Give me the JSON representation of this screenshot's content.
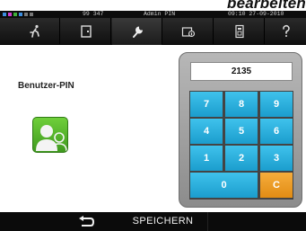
{
  "page": {
    "heading": "bearbeiten"
  },
  "status_bar": {
    "value": "99 347",
    "user": "Admin PIN",
    "datetime": "09:10 27-09-2010"
  },
  "nav_tabs": [
    {
      "icon": "program-icon",
      "active": false
    },
    {
      "icon": "door-icon",
      "active": false
    },
    {
      "icon": "wrench-icon",
      "active": true
    },
    {
      "icon": "info-device-icon",
      "active": false
    },
    {
      "icon": "keypad-device-icon",
      "active": false
    },
    {
      "icon": "help-icon",
      "active": false
    }
  ],
  "pin_section": {
    "label": "Benutzer-PIN",
    "avatar_icon": "user-avatar-icon"
  },
  "keypad": {
    "display": "2135",
    "keys": [
      "7",
      "8",
      "9",
      "4",
      "5",
      "6",
      "1",
      "2",
      "3",
      "0",
      "C"
    ]
  },
  "bottom_bar": {
    "back_icon": "back-arrow-icon",
    "save_label": "SPEICHERN"
  },
  "colors": {
    "key_blue": "#29AEDD",
    "key_clear_orange": "#EE9B22",
    "avatar_green": "#56B52B",
    "bar_dark": "#0B0B0B"
  }
}
